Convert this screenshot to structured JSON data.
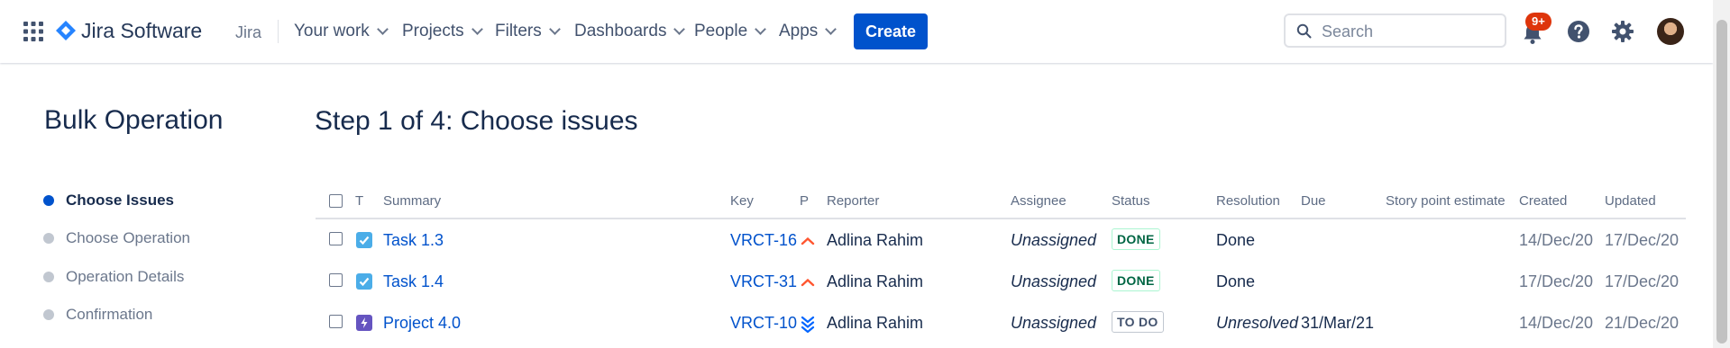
{
  "nav": {
    "product": "Jira Software",
    "site": "Jira",
    "items": [
      "Your work",
      "Projects",
      "Filters",
      "Dashboards",
      "People",
      "Apps"
    ],
    "create_label": "Create",
    "search_placeholder": "Search",
    "notification_badge": "9+"
  },
  "sidebar": {
    "title": "Bulk Operation",
    "steps": [
      "Choose Issues",
      "Choose Operation",
      "Operation Details",
      "Confirmation"
    ]
  },
  "main": {
    "title": "Step 1 of 4: Choose issues",
    "columns": [
      "T",
      "Summary",
      "Key",
      "P",
      "Reporter",
      "Assignee",
      "Status",
      "Resolution",
      "Due",
      "Story point estimate",
      "Created",
      "Updated"
    ],
    "rows": [
      {
        "type": "task",
        "summary": "Task 1.3",
        "key": "VRCT-16",
        "priority": "high",
        "reporter": "Adlina Rahim",
        "assignee": "Unassigned",
        "status": "DONE",
        "resolution": "Done",
        "due": "",
        "created": "14/Dec/20",
        "updated": "17/Dec/20"
      },
      {
        "type": "task",
        "summary": "Task 1.4",
        "key": "VRCT-31",
        "priority": "high",
        "reporter": "Adlina Rahim",
        "assignee": "Unassigned",
        "status": "DONE",
        "resolution": "Done",
        "due": "",
        "created": "17/Dec/20",
        "updated": "17/Dec/20"
      },
      {
        "type": "epic",
        "summary": "Project 4.0",
        "key": "VRCT-10",
        "priority": "lowest",
        "reporter": "Adlina Rahim",
        "assignee": "Unassigned",
        "status": "TO DO",
        "resolution": "Unresolved",
        "due": "31/Mar/21",
        "created": "14/Dec/20",
        "updated": "21/Dec/20"
      }
    ]
  },
  "colors": {
    "brand": "#0052cc",
    "done": "#006644",
    "priority_high": "#ff5630",
    "epic": "#6554c0",
    "task": "#4bade8"
  }
}
